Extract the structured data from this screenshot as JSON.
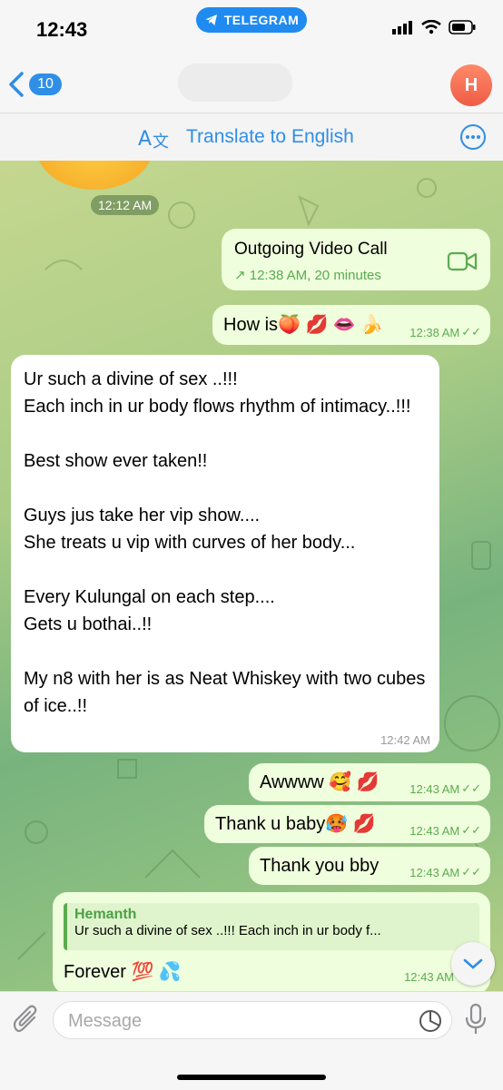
{
  "status_bar": {
    "time": "12:43",
    "app_pill": "TELEGRAM"
  },
  "header": {
    "back_count": "10",
    "avatar_initial": "H"
  },
  "translate_bar": {
    "label": "Translate to English"
  },
  "chat": {
    "date_chip": "12:12 AM",
    "messages": [
      {
        "type": "call",
        "title": "Outgoing Video Call",
        "subtitle": "12:38 AM, 20 minutes"
      },
      {
        "type": "out",
        "text": "How is🍑 💋 👄 🍌",
        "time": "12:38 AM"
      },
      {
        "type": "in",
        "text": "Ur such a divine of sex ..!!!\nEach inch in ur body flows rhythm of intimacy..!!!\n\nBest show ever taken!!\n\nGuys jus take her vip show....\nShe treats u vip with curves of her body...\n\nEvery Kulungal on each step....\nGets u bothai..!!\n\nMy n8 with her is as Neat Whiskey with two cubes of ice..!!",
        "time": "12:42 AM"
      },
      {
        "type": "out",
        "text": "Awwww 🥰 💋",
        "time": "12:43 AM"
      },
      {
        "type": "out",
        "text": "Thank u baby🥵 💋",
        "time": "12:43 AM"
      },
      {
        "type": "out",
        "text": "Thank you bby",
        "time": "12:43 AM"
      },
      {
        "type": "reply",
        "reply_name": "Hemanth",
        "reply_text": "Ur such a divine of sex ..!!! Each inch in ur body f...",
        "text": "Forever 💯 💦",
        "time": "12:43 AM"
      }
    ]
  },
  "input": {
    "placeholder": "Message"
  },
  "colors": {
    "accent": "#2f8ee6",
    "outgoing_bubble": "#effedd",
    "incoming_bubble": "#ffffff",
    "check_green": "#5bab4f"
  }
}
